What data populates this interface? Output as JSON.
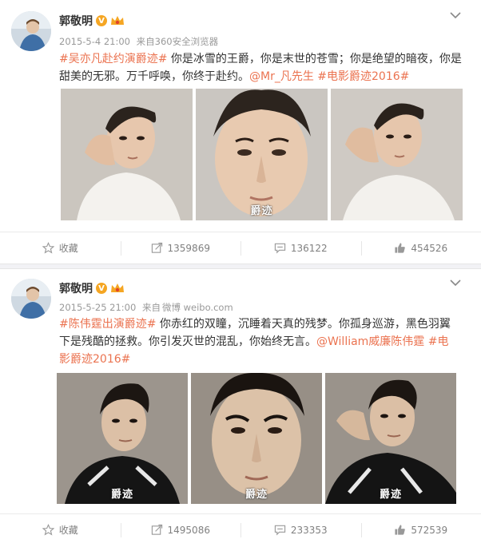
{
  "posts": [
    {
      "author": "郭敬明",
      "badge": "V",
      "time": "2015-5-4 21:00",
      "source_prefix": "来自",
      "source": "360安全浏览器",
      "text_parts": [
        {
          "kind": "tag",
          "text": "#吴亦凡赴约演爵迹#"
        },
        {
          "kind": "plain",
          "text": " 你是冰雪的王爵，你是末世的苍雪；你是绝望的暗夜，你是甜美的无邪。万千呼唤，你终于赴约。"
        },
        {
          "kind": "mention",
          "text": "@Mr_凡先生"
        },
        {
          "kind": "plain",
          "text": " "
        },
        {
          "kind": "tag",
          "text": "#电影爵迹2016#"
        }
      ],
      "photo_watermark": "爵迹",
      "actions": {
        "favorite": "收藏",
        "repost": "1359869",
        "comment": "136122",
        "like": "454526"
      }
    },
    {
      "author": "郭敬明",
      "badge": "V",
      "time": "2015-5-25 21:00",
      "source_prefix": "来自",
      "source": "微博 weibo.com",
      "text_parts": [
        {
          "kind": "tag",
          "text": "#陈伟霆出演爵迹#"
        },
        {
          "kind": "plain",
          "text": " 你赤红的双瞳，沉睡着天真的残梦。你孤身巡游，黑色羽翼下是残酷的拯救。你引发灭世的混乱，你始终无言。"
        },
        {
          "kind": "mention",
          "text": "@William威廉陈伟霆"
        },
        {
          "kind": "plain",
          "text": " "
        },
        {
          "kind": "tag",
          "text": "#电影爵迹2016#"
        }
      ],
      "photo_watermark": "爵迹",
      "actions": {
        "favorite": "收藏",
        "repost": "1495086",
        "comment": "233353",
        "like": "572539"
      }
    }
  ],
  "colors": {
    "link": "#eb7350",
    "muted": "#999999",
    "action_text": "#808080",
    "badge": "#f5a623"
  },
  "icons": [
    "chevron-down-icon",
    "star-icon",
    "repost-icon",
    "comment-icon",
    "thumbs-up-icon",
    "crown-icon",
    "verified-icon"
  ]
}
